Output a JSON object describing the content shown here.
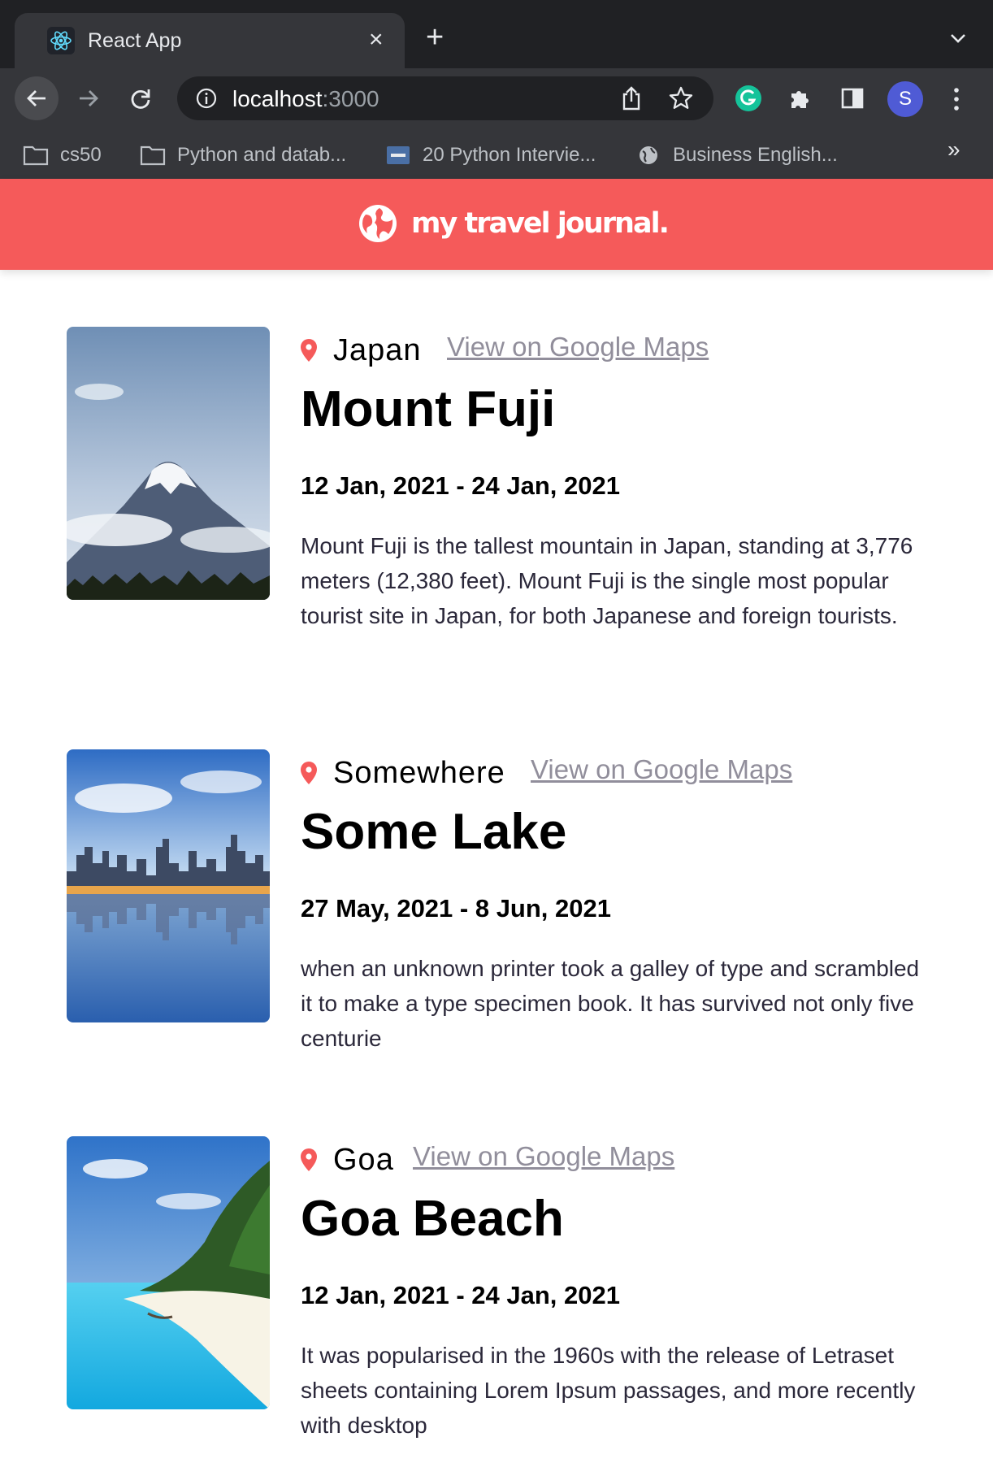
{
  "browser": {
    "tab_title": "React App",
    "tab_close": "×",
    "new_tab": "+",
    "url_host": "localhost",
    "url_port": ":3000",
    "profile_initial": "S",
    "more_bookmarks": "»",
    "bookmarks": [
      {
        "label": "cs50",
        "icon": "folder-icon"
      },
      {
        "label": "Python and datab...",
        "icon": "folder-icon"
      },
      {
        "label": "20 Python Intervie...",
        "icon": "tds-icon"
      },
      {
        "label": "Business English...",
        "icon": "globe-icon"
      }
    ],
    "colors": {
      "tabstrip": "#202124",
      "toolbar": "#35363a",
      "grammarly": "#15c39a",
      "avatar": "#4f5bd5"
    }
  },
  "app": {
    "brand": "my travel journal.",
    "colors": {
      "navbar": "#f55a5a",
      "pin": "#f55a5a",
      "link": "#918e9b",
      "text": "#2b283a"
    }
  },
  "entries": [
    {
      "country": "Japan",
      "map_link": "View on Google Maps",
      "title": "Mount Fuji",
      "dates": "12 Jan, 2021 - 24 Jan, 2021",
      "description": "Mount Fuji is the tallest mountain in Japan, standing at 3,776 meters (12,380 feet). Mount Fuji is the single most popular tourist site in Japan, for both Japanese and foreign tourists."
    },
    {
      "country": "Somewhere",
      "map_link": "View on Google Maps",
      "title": "Some Lake",
      "dates": "27 May, 2021 - 8 Jun, 2021",
      "description": "when an unknown printer took a galley of type and scrambled it to make a type specimen book. It has survived not only five centurie"
    },
    {
      "country": "Goa",
      "map_link": "View on Google Maps",
      "title": "Goa Beach",
      "dates": "12 Jan, 2021 - 24 Jan, 2021",
      "description": "It was popularised in the 1960s with the release of Letraset sheets containing Lorem Ipsum passages, and more recently with desktop"
    }
  ]
}
